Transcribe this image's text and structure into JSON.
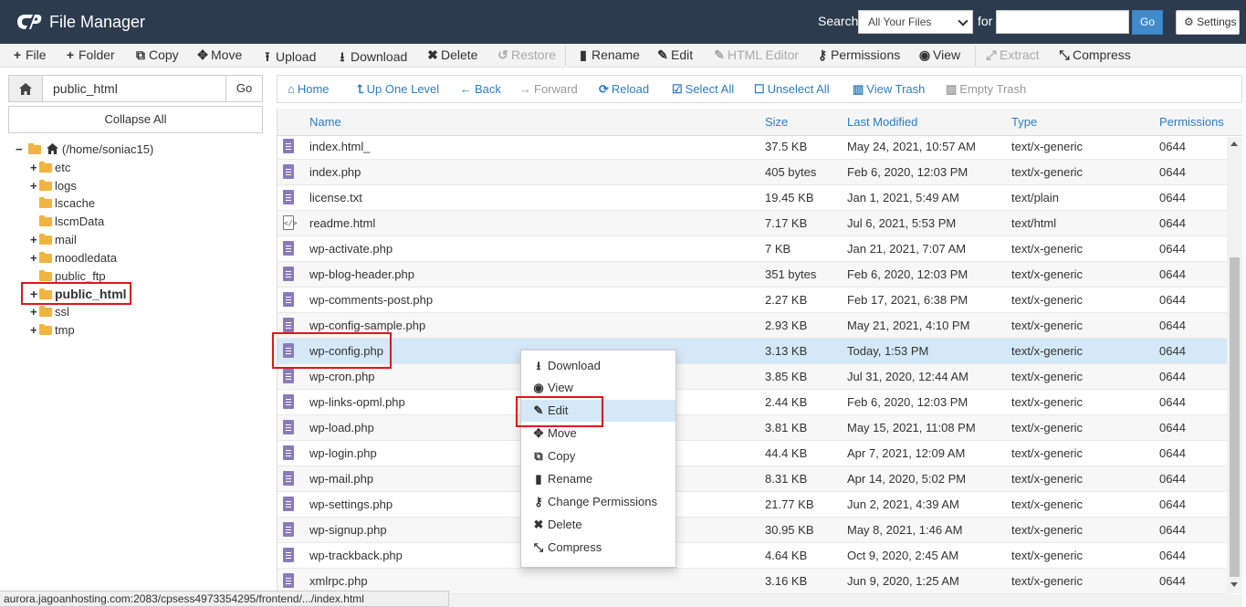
{
  "header": {
    "app_title": "File Manager",
    "search_label": "Search",
    "search_scope": "All Your Files",
    "for_label": "for",
    "search_value": "",
    "go_label": "Go",
    "settings_label": "Settings"
  },
  "toolbar": {
    "items": [
      {
        "label": "File",
        "icon": "plus-icon",
        "glyph": "+",
        "enabled": true
      },
      {
        "label": "Folder",
        "icon": "plus-icon",
        "glyph": "+",
        "enabled": true
      },
      {
        "label": "Copy",
        "icon": "copy-icon",
        "glyph": "⧉",
        "enabled": true
      },
      {
        "label": "Move",
        "icon": "move-icon",
        "glyph": "✥",
        "enabled": true
      },
      {
        "label": "Upload",
        "icon": "upload-icon",
        "glyph": "⭱",
        "enabled": true
      },
      {
        "label": "Download",
        "icon": "download-icon",
        "glyph": "⭳",
        "enabled": true
      },
      {
        "label": "Delete",
        "icon": "delete-icon",
        "glyph": "✖",
        "enabled": true
      },
      {
        "label": "Restore",
        "icon": "restore-icon",
        "glyph": "↺",
        "enabled": false
      },
      {
        "label": "Rename",
        "icon": "file-icon",
        "glyph": "▮",
        "enabled": true
      },
      {
        "label": "Edit",
        "icon": "pencil-icon",
        "glyph": "✎",
        "enabled": true
      },
      {
        "label": "HTML Editor",
        "icon": "html-editor-icon",
        "glyph": "✎",
        "enabled": false
      },
      {
        "label": "Permissions",
        "icon": "key-icon",
        "glyph": "⚷",
        "enabled": true
      },
      {
        "label": "View",
        "icon": "eye-icon",
        "glyph": "◉",
        "enabled": true
      },
      {
        "label": "Extract",
        "icon": "extract-icon",
        "glyph": "⤢",
        "enabled": false
      },
      {
        "label": "Compress",
        "icon": "compress-icon",
        "glyph": "⤡",
        "enabled": true
      }
    ]
  },
  "sidebar": {
    "path_value": "public_html",
    "go_label": "Go",
    "collapse_all": "Collapse All",
    "tree": [
      {
        "label": "(/home/soniac15)",
        "toggle": "−",
        "level": 0,
        "highlight": false
      },
      {
        "label": "etc",
        "toggle": "+",
        "level": 1,
        "highlight": false
      },
      {
        "label": "logs",
        "toggle": "+",
        "level": 1,
        "highlight": false
      },
      {
        "label": "lscache",
        "toggle": "",
        "level": 1,
        "highlight": false
      },
      {
        "label": "lscmData",
        "toggle": "",
        "level": 1,
        "highlight": false
      },
      {
        "label": "mail",
        "toggle": "+",
        "level": 1,
        "highlight": false
      },
      {
        "label": "moodledata",
        "toggle": "+",
        "level": 1,
        "highlight": false
      },
      {
        "label": "public_ftp",
        "toggle": "",
        "level": 1,
        "highlight": false
      },
      {
        "label": "public_html",
        "toggle": "+",
        "level": 1,
        "highlight": true
      },
      {
        "label": "ssl",
        "toggle": "+",
        "level": 1,
        "highlight": false
      },
      {
        "label": "tmp",
        "toggle": "+",
        "level": 1,
        "highlight": false
      }
    ]
  },
  "nav": {
    "items": [
      {
        "label": "Home",
        "icon": "home-icon",
        "glyph": "⌂",
        "enabled": true
      },
      {
        "label": "Up One Level",
        "icon": "level-up-icon",
        "glyph": "⮤",
        "enabled": true
      },
      {
        "label": "Back",
        "icon": "arrow-left-icon",
        "glyph": "←",
        "enabled": true
      },
      {
        "label": "Forward",
        "icon": "arrow-right-icon",
        "glyph": "→",
        "enabled": false
      },
      {
        "label": "Reload",
        "icon": "reload-icon",
        "glyph": "⟳",
        "enabled": true
      },
      {
        "label": "Select All",
        "icon": "checkbox-checked-icon",
        "glyph": "☑",
        "enabled": true
      },
      {
        "label": "Unselect All",
        "icon": "checkbox-empty-icon",
        "glyph": "☐",
        "enabled": true
      },
      {
        "label": "View Trash",
        "icon": "trash-icon",
        "glyph": "🗑",
        "enabled": true
      },
      {
        "label": "Empty Trash",
        "icon": "trash-icon",
        "glyph": "🗑",
        "enabled": false
      }
    ]
  },
  "table": {
    "columns": [
      "Name",
      "Size",
      "Last Modified",
      "Type",
      "Permissions"
    ],
    "rows": [
      {
        "name": "index.html_",
        "size": "37.5 KB",
        "modified": "May 24, 2021, 10:57 AM",
        "type": "text/x-generic",
        "perms": "0644",
        "kind": "generic"
      },
      {
        "name": "index.php",
        "size": "405 bytes",
        "modified": "Feb 6, 2020, 12:03 PM",
        "type": "text/x-generic",
        "perms": "0644",
        "kind": "generic"
      },
      {
        "name": "license.txt",
        "size": "19.45 KB",
        "modified": "Jan 1, 2021, 5:49 AM",
        "type": "text/plain",
        "perms": "0644",
        "kind": "generic"
      },
      {
        "name": "readme.html",
        "size": "7.17 KB",
        "modified": "Jul 6, 2021, 5:53 PM",
        "type": "text/html",
        "perms": "0644",
        "kind": "html"
      },
      {
        "name": "wp-activate.php",
        "size": "7 KB",
        "modified": "Jan 21, 2021, 7:07 AM",
        "type": "text/x-generic",
        "perms": "0644",
        "kind": "generic"
      },
      {
        "name": "wp-blog-header.php",
        "size": "351 bytes",
        "modified": "Feb 6, 2020, 12:03 PM",
        "type": "text/x-generic",
        "perms": "0644",
        "kind": "generic"
      },
      {
        "name": "wp-comments-post.php",
        "size": "2.27 KB",
        "modified": "Feb 17, 2021, 6:38 PM",
        "type": "text/x-generic",
        "perms": "0644",
        "kind": "generic"
      },
      {
        "name": "wp-config-sample.php",
        "size": "2.93 KB",
        "modified": "May 21, 2021, 4:10 PM",
        "type": "text/x-generic",
        "perms": "0644",
        "kind": "generic"
      },
      {
        "name": "wp-config.php",
        "size": "3.13 KB",
        "modified": "Today, 1:53 PM",
        "type": "text/x-generic",
        "perms": "0644",
        "kind": "generic",
        "selected": true
      },
      {
        "name": "wp-cron.php",
        "size": "3.85 KB",
        "modified": "Jul 31, 2020, 12:44 AM",
        "type": "text/x-generic",
        "perms": "0644",
        "kind": "generic"
      },
      {
        "name": "wp-links-opml.php",
        "size": "2.44 KB",
        "modified": "Feb 6, 2020, 12:03 PM",
        "type": "text/x-generic",
        "perms": "0644",
        "kind": "generic"
      },
      {
        "name": "wp-load.php",
        "size": "3.81 KB",
        "modified": "May 15, 2021, 11:08 PM",
        "type": "text/x-generic",
        "perms": "0644",
        "kind": "generic"
      },
      {
        "name": "wp-login.php",
        "size": "44.4 KB",
        "modified": "Apr 7, 2021, 12:09 AM",
        "type": "text/x-generic",
        "perms": "0644",
        "kind": "generic"
      },
      {
        "name": "wp-mail.php",
        "size": "8.31 KB",
        "modified": "Apr 14, 2020, 5:02 PM",
        "type": "text/x-generic",
        "perms": "0644",
        "kind": "generic"
      },
      {
        "name": "wp-settings.php",
        "size": "21.77 KB",
        "modified": "Jun 2, 2021, 4:39 AM",
        "type": "text/x-generic",
        "perms": "0644",
        "kind": "generic"
      },
      {
        "name": "wp-signup.php",
        "size": "30.95 KB",
        "modified": "May 8, 2021, 1:46 AM",
        "type": "text/x-generic",
        "perms": "0644",
        "kind": "generic"
      },
      {
        "name": "wp-trackback.php",
        "size": "4.64 KB",
        "modified": "Oct 9, 2020, 2:45 AM",
        "type": "text/x-generic",
        "perms": "0644",
        "kind": "generic"
      },
      {
        "name": "xmlrpc.php",
        "size": "3.16 KB",
        "modified": "Jun 9, 2020, 1:25 AM",
        "type": "text/x-generic",
        "perms": "0644",
        "kind": "generic"
      }
    ]
  },
  "context_menu": {
    "items": [
      {
        "label": "Download",
        "icon": "download-icon",
        "glyph": "⭳"
      },
      {
        "label": "View",
        "icon": "eye-icon",
        "glyph": "◉"
      },
      {
        "label": "Edit",
        "icon": "pencil-icon",
        "glyph": "✎",
        "hover": true
      },
      {
        "label": "Move",
        "icon": "move-icon",
        "glyph": "✥"
      },
      {
        "label": "Copy",
        "icon": "copy-icon",
        "glyph": "⧉"
      },
      {
        "label": "Rename",
        "icon": "file-icon",
        "glyph": "▮"
      },
      {
        "label": "Change Permissions",
        "icon": "key-icon",
        "glyph": "⚷"
      },
      {
        "label": "Delete",
        "icon": "delete-icon",
        "glyph": "✖"
      },
      {
        "label": "Compress",
        "icon": "compress-icon",
        "glyph": "⤡"
      }
    ]
  },
  "statusbar": {
    "url": "aurora.jagoanhosting.com:2083/cpsess4973354295/frontend/.../index.html"
  },
  "colors": {
    "header_bg": "#2d3b4e",
    "accent": "#2a7dc7",
    "highlight_box": "#e0161b",
    "selected_row": "#d4e8f7"
  }
}
